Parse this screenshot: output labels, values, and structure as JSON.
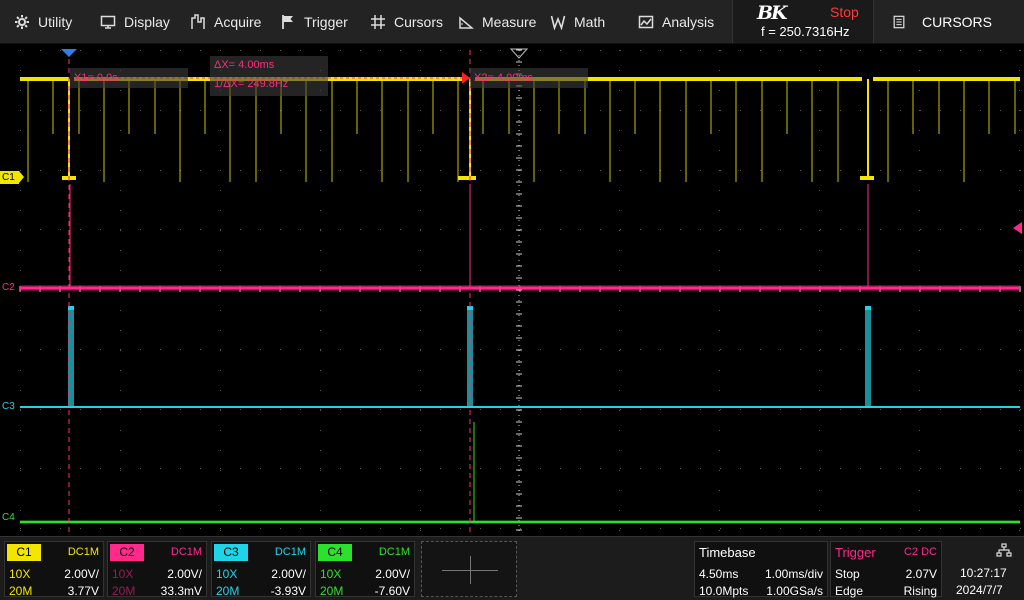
{
  "menu": {
    "utility": "Utility",
    "display": "Display",
    "acquire": "Acquire",
    "trigger": "Trigger",
    "cursors": "Cursors",
    "measure": "Measure",
    "math": "Math",
    "analysis": "Analysis"
  },
  "brand": {
    "logo": "BK",
    "run_state": "Stop",
    "frequency": "f = 250.7316Hz"
  },
  "side_panel": {
    "title": "CURSORS"
  },
  "channels": [
    {
      "id": "C1",
      "coupling": "DC1M",
      "probe": "10X",
      "scale": "2.00V/",
      "bandwidth": "20M",
      "offset": "3.77V",
      "color": "#f2e600"
    },
    {
      "id": "C2",
      "coupling": "DC1M",
      "probe": "10X",
      "scale": "2.00V/",
      "bandwidth": "20M",
      "offset": "33.3mV",
      "color": "#ff2a8c"
    },
    {
      "id": "C3",
      "coupling": "DC1M",
      "probe": "10X",
      "scale": "2.00V/",
      "bandwidth": "20M",
      "offset": "-3.93V",
      "color": "#20d4e8"
    },
    {
      "id": "C4",
      "coupling": "DC1M",
      "probe": "10X",
      "scale": "2.00V/",
      "bandwidth": "20M",
      "offset": "-7.60V",
      "color": "#2ee02e"
    }
  ],
  "cursors": {
    "x1": "X1= 0.0s",
    "x2": "X2= 4.00ms",
    "delta": "ΔX= 4.00ms",
    "inverse_delta": "1/ΔX= 249.8Hz"
  },
  "timebase": {
    "title": "Timebase",
    "delay": "4.50ms",
    "scale": "1.00ms/div",
    "memory": "10.0Mpts",
    "sample_rate": "1.00GSa/s"
  },
  "trigger": {
    "title": "Trigger",
    "source": "C2 DC",
    "mode": "Stop",
    "level": "2.07V",
    "type": "Edge",
    "slope": "Rising"
  },
  "system": {
    "time": "10:27:17",
    "date": "2024/7/7"
  }
}
